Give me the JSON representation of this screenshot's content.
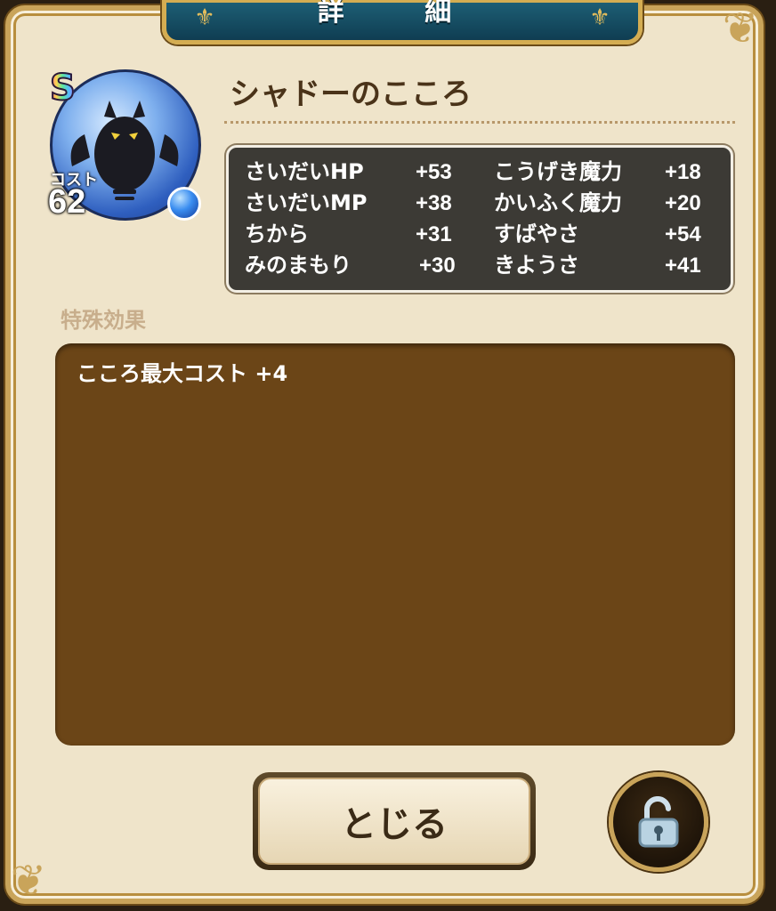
{
  "header": {
    "title": "詳 細"
  },
  "item": {
    "rank": "S",
    "cost_label": "コスト",
    "cost_value": "62",
    "name": "シャドーのこころ"
  },
  "stats": [
    {
      "label": "さいだいHP",
      "value": "+53"
    },
    {
      "label": "さいだいMP",
      "value": "+38"
    },
    {
      "label": "ちから",
      "value": "+31"
    },
    {
      "label": "みのまもり",
      "value": "+30"
    },
    {
      "label": "こうげき魔力",
      "value": "+18"
    },
    {
      "label": "かいふく魔力",
      "value": "+20"
    },
    {
      "label": "すばやさ",
      "value": "+54"
    },
    {
      "label": "きようさ",
      "value": "+41"
    }
  ],
  "effects": {
    "label": "特殊効果",
    "items": [
      "こころ最大コスト +4"
    ]
  },
  "buttons": {
    "close_label": "とじる",
    "lock_icon": "unlocked-padlock-icon"
  },
  "colors": {
    "panel_bg": "#efe4ca",
    "frame_gold": "#c9a45a",
    "title_plate": "#1d5e74",
    "stats_bg": "#3c3a35",
    "effects_bg": "#6b4517"
  }
}
